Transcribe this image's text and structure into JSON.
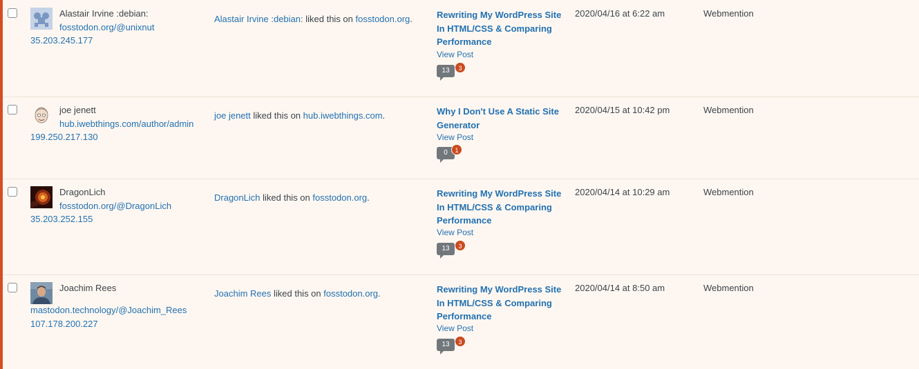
{
  "colors": {
    "accent_border": "#d54e21",
    "link": "#2271b1",
    "row_background": "#fef7f1",
    "badge": "#ca4a1f",
    "bubble": "#72777c"
  },
  "rows": [
    {
      "avatar_icon": "gravatar-blue-shapes-icon",
      "author_name": "Alastair Irvine :debian:",
      "author_url": "fosstodon.org/@unixnut",
      "author_ip": "35.203.245.177",
      "comment_author_link": "Alastair Irvine :debian:",
      "comment_middle": " liked this on ",
      "comment_site_link": "fosstodon.org",
      "comment_end": ".",
      "post_title": "Rewriting My WordPress Site In HTML/CSS & Comparing Performance",
      "view_post": "View Post",
      "approved_count": "13",
      "pending_count": "3",
      "submitted_on": "2020/04/16 at 6:22 am",
      "type": "Webmention"
    },
    {
      "avatar_icon": "cartoon-face-avatar-icon",
      "author_name": "joe jenett",
      "author_url": "hub.iwebthings.com/author/admin",
      "author_ip": "199.250.217.130",
      "comment_author_link": "joe jenett",
      "comment_middle": " liked this on ",
      "comment_site_link": "hub.iwebthings.com",
      "comment_end": ".",
      "post_title": "Why I Don't Use A Static Site Generator",
      "view_post": "View Post",
      "approved_count": "0",
      "pending_count": "1",
      "submitted_on": "2020/04/15 at 10:42 pm",
      "type": "Webmention"
    },
    {
      "avatar_icon": "dragon-avatar-icon",
      "author_name": "DragonLich",
      "author_url": "fosstodon.org/@DragonLich",
      "author_ip": "35.203.252.155",
      "comment_author_link": "DragonLich",
      "comment_middle": " liked this on ",
      "comment_site_link": "fosstodon.org",
      "comment_end": ".",
      "post_title": "Rewriting My WordPress Site In HTML/CSS & Comparing Performance",
      "view_post": "View Post",
      "approved_count": "13",
      "pending_count": "3",
      "submitted_on": "2020/04/14 at 10:29 am",
      "type": "Webmention"
    },
    {
      "avatar_icon": "person-photo-avatar-icon",
      "author_name": "Joachim Rees",
      "author_url": "mastodon.technology/@Joachim_Rees",
      "author_ip": "107.178.200.227",
      "comment_author_link": "Joachim Rees",
      "comment_middle": " liked this on ",
      "comment_site_link": "fosstodon.org",
      "comment_end": ".",
      "post_title": "Rewriting My WordPress Site In HTML/CSS & Comparing Performance",
      "view_post": "View Post",
      "approved_count": "13",
      "pending_count": "3",
      "submitted_on": "2020/04/14 at 8:50 am",
      "type": "Webmention"
    }
  ]
}
